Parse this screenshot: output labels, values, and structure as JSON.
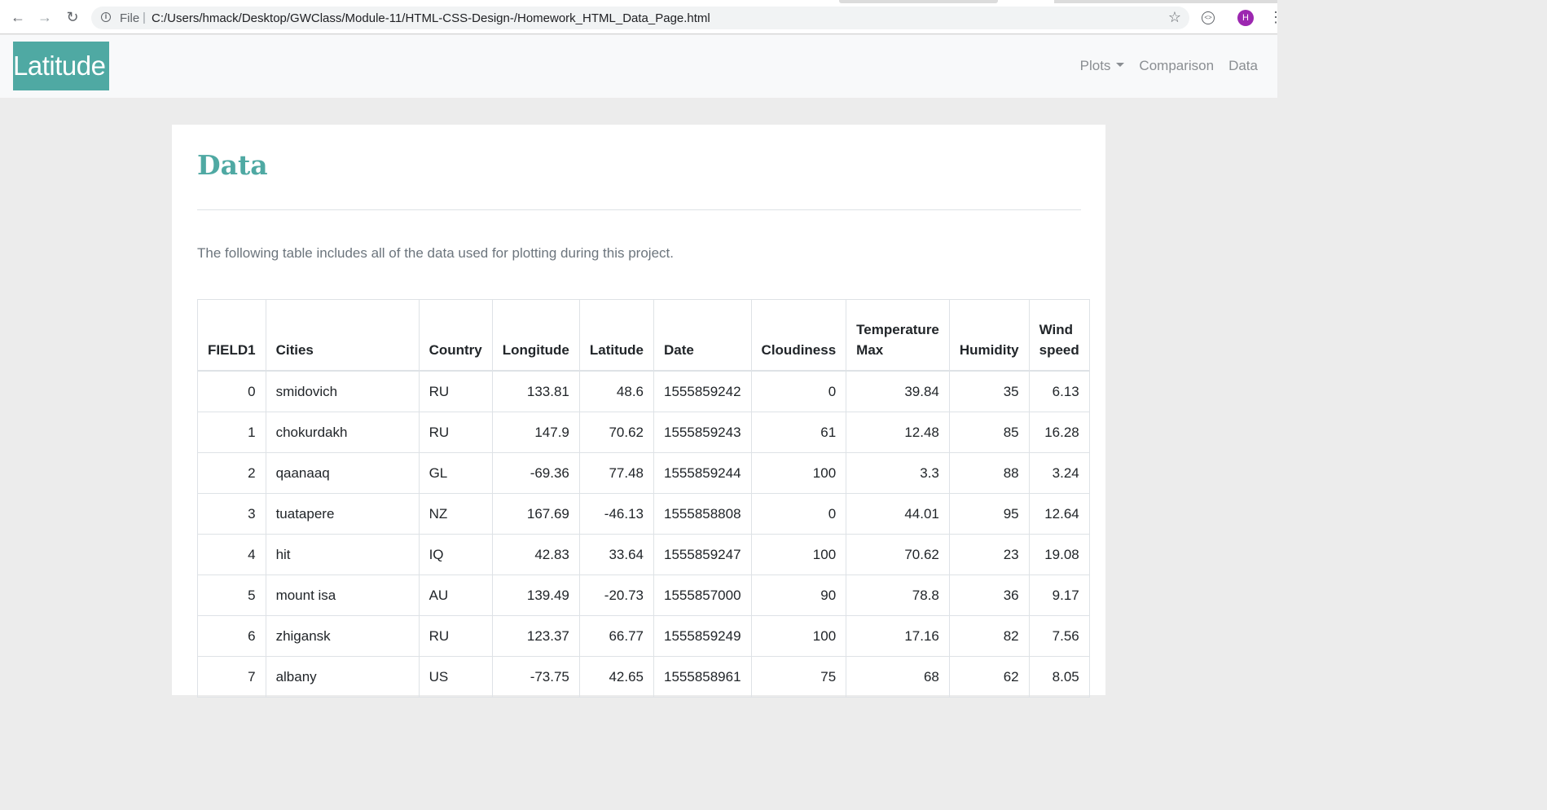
{
  "browser": {
    "file_label": "File",
    "url": "C:/Users/hmack/Desktop/GWClass/Module-11/HTML-CSS-Design-/Homework_HTML_Data_Page.html",
    "profile_initial": "H",
    "icons": [
      "back-arrow-icon",
      "forward-arrow-icon",
      "reload-icon",
      "info-icon",
      "star-icon",
      "extension-icon",
      "kebab-menu-icon"
    ]
  },
  "navbar": {
    "brand": "Latitude",
    "links": [
      "Plots",
      "Comparison",
      "Data"
    ],
    "colors": {
      "brand_bg": "#4fa9a3"
    }
  },
  "main": {
    "title": "Data",
    "lead": "The following table includes all of the data used for plotting during this project.",
    "table": {
      "headers": [
        "FIELD1",
        "Cities",
        "Country",
        "Longitude",
        "Latitude",
        "Date",
        "Cloudiness",
        "Temperature Max",
        "Humidity",
        "Wind speed"
      ],
      "rows": [
        [
          "0",
          "smidovich",
          "RU",
          "133.81",
          "48.6",
          "1555859242",
          "0",
          "39.84",
          "35",
          "6.13"
        ],
        [
          "1",
          "chokurdakh",
          "RU",
          "147.9",
          "70.62",
          "1555859243",
          "61",
          "12.48",
          "85",
          "16.28"
        ],
        [
          "2",
          "qaanaaq",
          "GL",
          "-69.36",
          "77.48",
          "1555859244",
          "100",
          "3.3",
          "88",
          "3.24"
        ],
        [
          "3",
          "tuatapere",
          "NZ",
          "167.69",
          "-46.13",
          "1555858808",
          "0",
          "44.01",
          "95",
          "12.64"
        ],
        [
          "4",
          "hit",
          "IQ",
          "42.83",
          "33.64",
          "1555859247",
          "100",
          "70.62",
          "23",
          "19.08"
        ],
        [
          "5",
          "mount isa",
          "AU",
          "139.49",
          "-20.73",
          "1555857000",
          "90",
          "78.8",
          "36",
          "9.17"
        ],
        [
          "6",
          "zhigansk",
          "RU",
          "123.37",
          "66.77",
          "1555859249",
          "100",
          "17.16",
          "82",
          "7.56"
        ],
        [
          "7",
          "albany",
          "US",
          "-73.75",
          "42.65",
          "1555858961",
          "75",
          "68",
          "62",
          "8.05"
        ]
      ]
    }
  }
}
